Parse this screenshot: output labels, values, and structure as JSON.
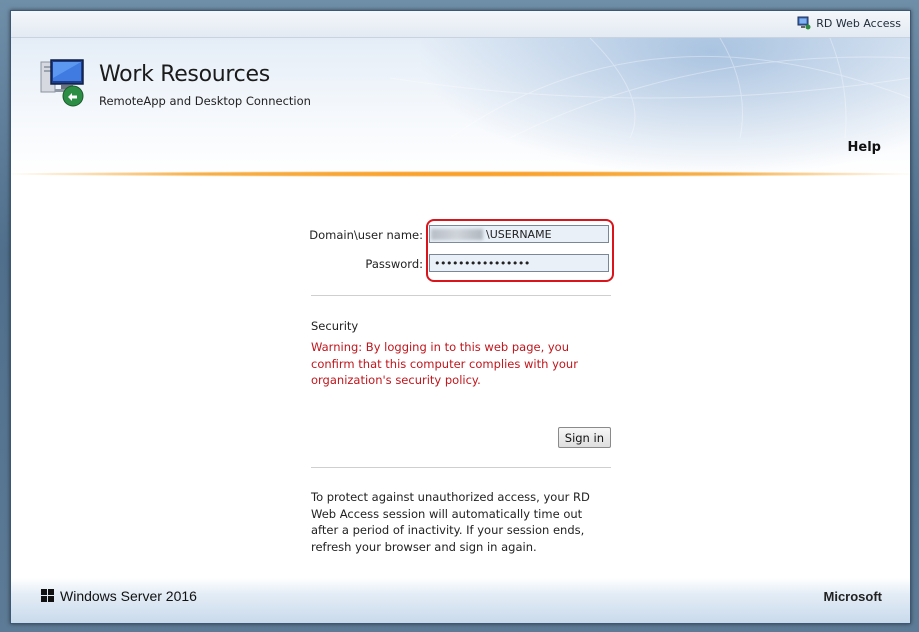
{
  "topbar": {
    "rdwa_label": "RD Web Access",
    "icon": "rd-web-access-icon"
  },
  "header": {
    "title": "Work Resources",
    "subtitle": "RemoteApp and Desktop Connection",
    "icon": "remote-desktop-computer-icon",
    "help_label": "Help"
  },
  "login": {
    "username_label": "Domain\\user name:",
    "username_value": "\\USERNAME",
    "password_label": "Password:",
    "password_value": "••••••••••••••••",
    "security_title": "Security",
    "warning": "Warning: By logging in to this web page, you confirm that this computer complies with your organization's security policy.",
    "signin_label": "Sign in",
    "notice": "To protect against unauthorized access, your RD Web Access session will automatically time out after a period of inactivity. If your session ends, refresh your browser and sign in again."
  },
  "footer": {
    "os_label": "Windows Server 2016",
    "brand": "Microsoft",
    "icon": "windows-logo-icon"
  },
  "colors": {
    "warning": "#c0161c",
    "accent_line": "#ff9a1a",
    "highlight_border": "#d9141b"
  }
}
